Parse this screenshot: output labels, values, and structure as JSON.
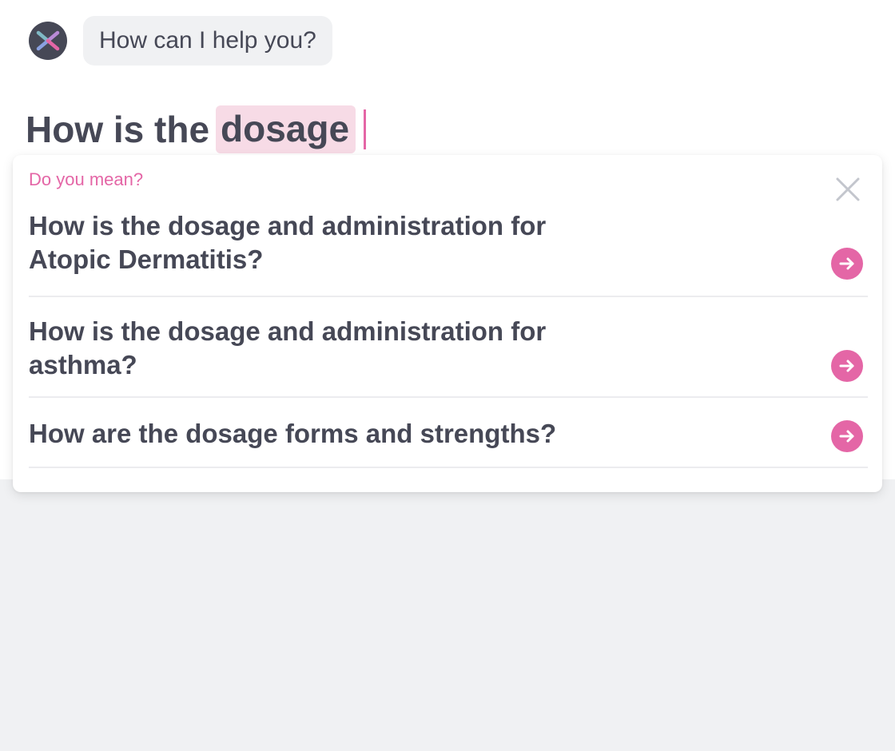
{
  "assistant": {
    "avatar_icon": "x-logo-icon",
    "greeting": "How can I help you?"
  },
  "query": {
    "prefix": "How is the",
    "highlighted": "dosage"
  },
  "suggestions_panel": {
    "title": "Do you mean?",
    "close_icon": "close-icon",
    "items": [
      {
        "line1": "How is the dosage and administration for",
        "line2": "Atopic Dermatitis?"
      },
      {
        "line1": "How is the dosage and administration for",
        "line2": "asthma?"
      },
      {
        "line1": "How are the dosage forms and strengths?"
      }
    ],
    "item_icon": "arrow-right-icon"
  },
  "colors": {
    "accent": "#e466a6",
    "text": "#464856",
    "highlight_bg": "#f7dbe6",
    "bubble_bg": "#f0f1f3",
    "page_bg": "#f0f1f3"
  }
}
